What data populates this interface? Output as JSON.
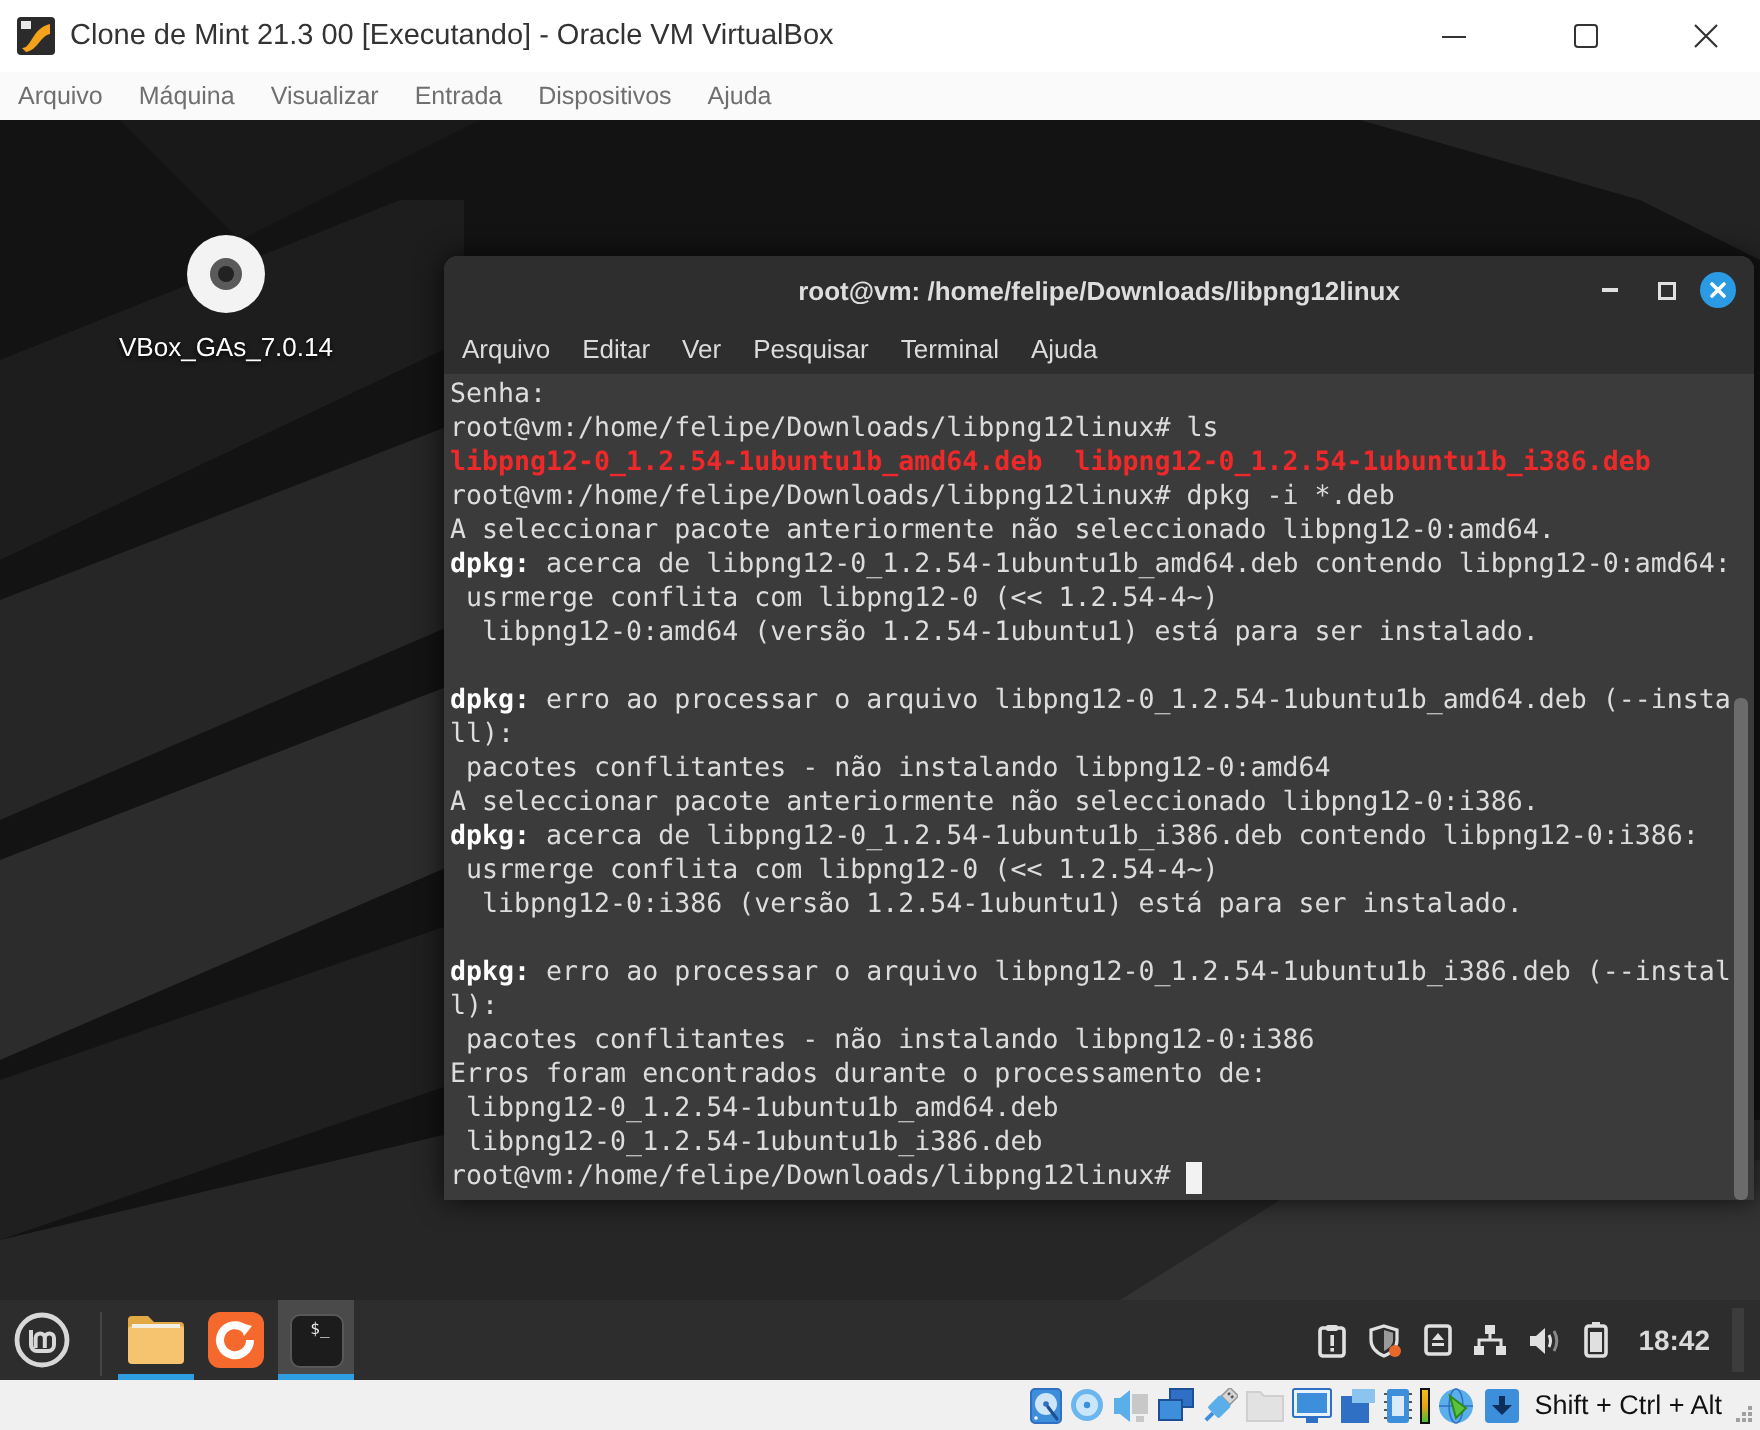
{
  "window": {
    "title": "Clone de Mint 21.3 00 [Executando] - Oracle VM VirtualBox"
  },
  "menu_bar": [
    "Arquivo",
    "Máquina",
    "Visualizar",
    "Entrada",
    "Dispositivos",
    "Ajuda"
  ],
  "desktop": {
    "icons": [
      {
        "kind": "disc",
        "label": "VBox_GAs_7.0.14"
      }
    ]
  },
  "terminal": {
    "title": "root@vm: /home/felipe/Downloads/libpng12linux",
    "menu": [
      "Arquivo",
      "Editar",
      "Ver",
      "Pesquisar",
      "Terminal",
      "Ajuda"
    ],
    "lines": [
      {
        "kind": "output",
        "text": "Senha:"
      },
      {
        "kind": "prompt",
        "text": "root@vm:/home/felipe/Downloads/libpng12linux# ls"
      },
      {
        "kind": "files",
        "files": [
          "libpng12-0_1.2.54-1ubuntu1b_amd64.deb",
          "libpng12-0_1.2.54-1ubuntu1b_i386.deb"
        ]
      },
      {
        "kind": "prompt",
        "text": "root@vm:/home/felipe/Downloads/libpng12linux# dpkg -i *.deb"
      },
      {
        "kind": "output",
        "text": "A seleccionar pacote anteriormente não seleccionado libpng12-0:amd64."
      },
      {
        "kind": "output",
        "text": "**dpkg:** acerca de libpng12-0_1.2.54-1ubuntu1b_amd64.deb contendo libpng12-0:amd64:"
      },
      {
        "kind": "output",
        "text": " usrmerge conflita com libpng12-0 (<< 1.2.54-4~)"
      },
      {
        "kind": "output",
        "text": "  libpng12-0:amd64 (versão 1.2.54-1ubuntu1) está para ser instalado."
      },
      {
        "kind": "blank"
      },
      {
        "kind": "output",
        "text": "**dpkg:** erro ao processar o arquivo libpng12-0_1.2.54-1ubuntu1b_amd64.deb (--insta"
      },
      {
        "kind": "output",
        "text": "ll):"
      },
      {
        "kind": "output",
        "text": " pacotes conflitantes - não instalando libpng12-0:amd64"
      },
      {
        "kind": "output",
        "text": "A seleccionar pacote anteriormente não seleccionado libpng12-0:i386."
      },
      {
        "kind": "output",
        "text": "**dpkg:** acerca de libpng12-0_1.2.54-1ubuntu1b_i386.deb contendo libpng12-0:i386:"
      },
      {
        "kind": "output",
        "text": " usrmerge conflita com libpng12-0 (<< 1.2.54-4~)"
      },
      {
        "kind": "output",
        "text": "  libpng12-0:i386 (versão 1.2.54-1ubuntu1) está para ser instalado."
      },
      {
        "kind": "blank"
      },
      {
        "kind": "output",
        "text": "**dpkg:** erro ao processar o arquivo libpng12-0_1.2.54-1ubuntu1b_i386.deb (--instal"
      },
      {
        "kind": "output",
        "text": "l):"
      },
      {
        "kind": "output",
        "text": " pacotes conflitantes - não instalando libpng12-0:i386"
      },
      {
        "kind": "output",
        "text": "Erros foram encontrados durante o processamento de:"
      },
      {
        "kind": "output",
        "text": " libpng12-0_1.2.54-1ubuntu1b_amd64.deb"
      },
      {
        "kind": "output",
        "text": " libpng12-0_1.2.54-1ubuntu1b_i386.deb"
      },
      {
        "kind": "prompt",
        "text": "root@vm:/home/felipe/Downloads/libpng12linux#",
        "cursor": true
      }
    ]
  },
  "taskbar": {
    "apps": [
      {
        "kind": "files",
        "running": true,
        "selected": false
      },
      {
        "kind": "browser",
        "running": false,
        "selected": false
      },
      {
        "kind": "terminal",
        "glyph": "$_",
        "running": true,
        "selected": true
      }
    ],
    "clock": "18:42"
  },
  "status_bar": {
    "host_key": "Shift + Ctrl + Alt"
  }
}
